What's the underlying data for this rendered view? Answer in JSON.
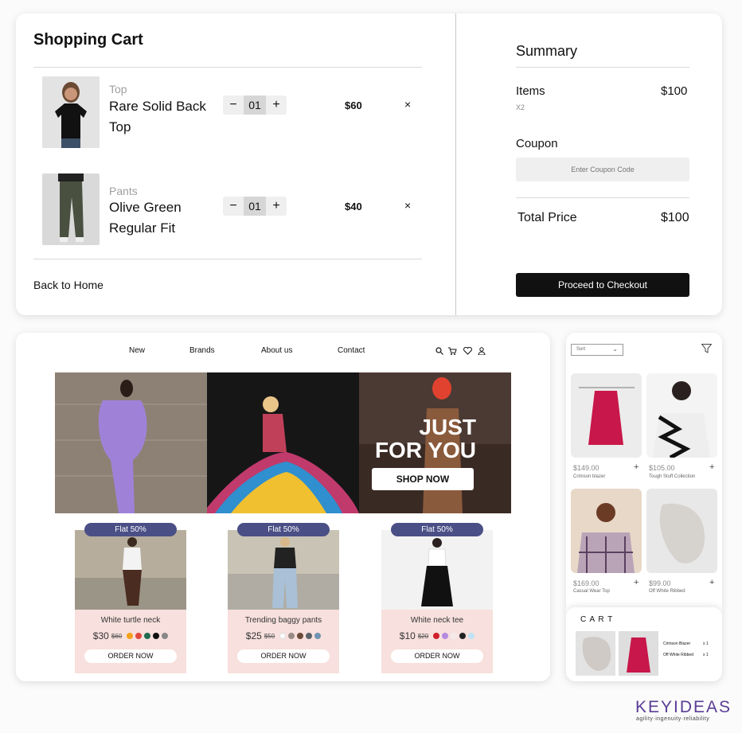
{
  "cart": {
    "title": "Shopping Cart",
    "items": [
      {
        "category": "Top",
        "name": "Rare Solid Back Top",
        "qty": "01",
        "price": "$60"
      },
      {
        "category": "Pants",
        "name": "Olive Green Regular Fit",
        "qty": "01",
        "price": "$40"
      }
    ],
    "remove_label": "×",
    "minus_label": "−",
    "plus_label": "+",
    "back_label": "Back to Home"
  },
  "summary": {
    "title": "Summary",
    "items_label": "Items",
    "items_value": "$100",
    "items_count": "X2",
    "coupon_label": "Coupon",
    "coupon_placeholder": "Enter Coupon Code",
    "total_label": "Total Price",
    "total_value": "$100",
    "checkout_label": "Proceed to Checkout"
  },
  "web": {
    "nav": [
      "New",
      "Brands",
      "About us",
      "Contact"
    ],
    "icons": [
      "search-icon",
      "cart-icon",
      "heart-icon",
      "user-icon"
    ],
    "hero_line1": "JUST",
    "hero_line2": "FOR YOU",
    "shop_label": "SHOP NOW",
    "products": [
      {
        "badge": "Flat 50%",
        "title": "White turtle neck",
        "price": "$30",
        "old": "$60",
        "colors": [
          "#f4a11c",
          "#e04a3e",
          "#1e6b50",
          "#111111",
          "#888888"
        ],
        "order": "ORDER NOW"
      },
      {
        "badge": "Flat 50%",
        "title": "Trending baggy pants",
        "price": "$25",
        "old": "$50",
        "colors": [
          "#ffffff",
          "#9a8a86",
          "#6b4a3a",
          "#59636b",
          "#6f93b0"
        ],
        "order": "ORDER NOW"
      },
      {
        "badge": "Flat 50%",
        "title": "White neck tee",
        "price": "$10",
        "old": "$20",
        "colors": [
          "#d01e2b",
          "#b48ae0",
          "#f7e8e6",
          "#222222",
          "#bfe3f5"
        ],
        "order": "ORDER NOW"
      }
    ]
  },
  "mobile": {
    "sort_label": "Sort",
    "products": [
      {
        "price": "$149.00",
        "name": "Crimson blazer"
      },
      {
        "price": "$105.00",
        "name": "Tough Stuff Collection"
      },
      {
        "price": "$169.00",
        "name": "Casual Wear Top"
      },
      {
        "price": "$99.00",
        "name": "Off White Ribbed"
      }
    ],
    "cart_title": "C A R T",
    "cart_items": [
      {
        "name": "Crimson Blazer",
        "qty": "x 1"
      },
      {
        "name": "Off White Ribbed",
        "qty": "x 1"
      }
    ]
  },
  "brand": {
    "name": "KEYIDEAS",
    "tagline": "agility·ingenuity·reliability"
  }
}
